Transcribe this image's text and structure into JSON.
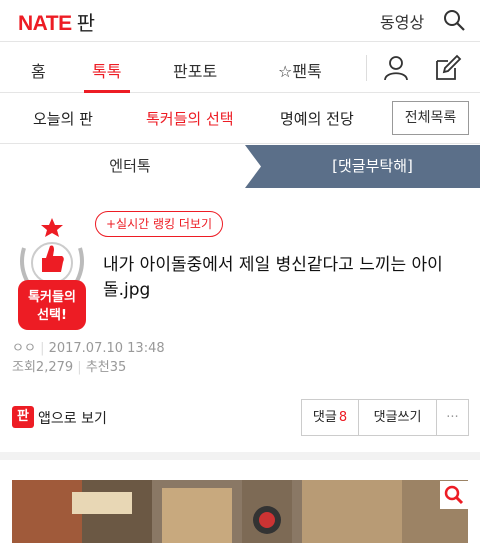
{
  "header": {
    "logo": "NATE",
    "section": "판",
    "video_label": "동영상",
    "search_icon": "search-icon"
  },
  "nav": [
    {
      "label": "홈"
    },
    {
      "label": "톡톡",
      "active": true
    },
    {
      "label": "판포토"
    },
    {
      "label": "☆팬톡"
    }
  ],
  "nav_icons": {
    "user": "user-icon",
    "write": "pencil-icon"
  },
  "subnav": [
    {
      "label": "오늘의 판"
    },
    {
      "label": "톡커들의 선택",
      "active": true
    },
    {
      "label": "명예의 전당"
    }
  ],
  "all_list_label": "전체목록",
  "category_tabs": {
    "left": "엔터톡",
    "right": "[댓글부탁해]"
  },
  "ranking_button": "+실시간 랭킹 더보기",
  "badge": {
    "line1": "톡커들의",
    "line2": "선택!"
  },
  "post": {
    "title": "내가 아이돌중에서 제일 병신같다고 느끼는 아이돌.jpg",
    "author": "ㅇㅇ",
    "date": "2017.07.10 13:48",
    "views": "조회2,279",
    "recommend": "추천35"
  },
  "app_label": "앱으로 보기",
  "app_icon_text": "판",
  "actions": {
    "comment_label": "댓글",
    "comment_count": "8",
    "write_comment": "댓글쓰기",
    "more": "···"
  },
  "colors": {
    "brand": "#ed1c24",
    "tab_active_bg": "#5b6f89"
  }
}
